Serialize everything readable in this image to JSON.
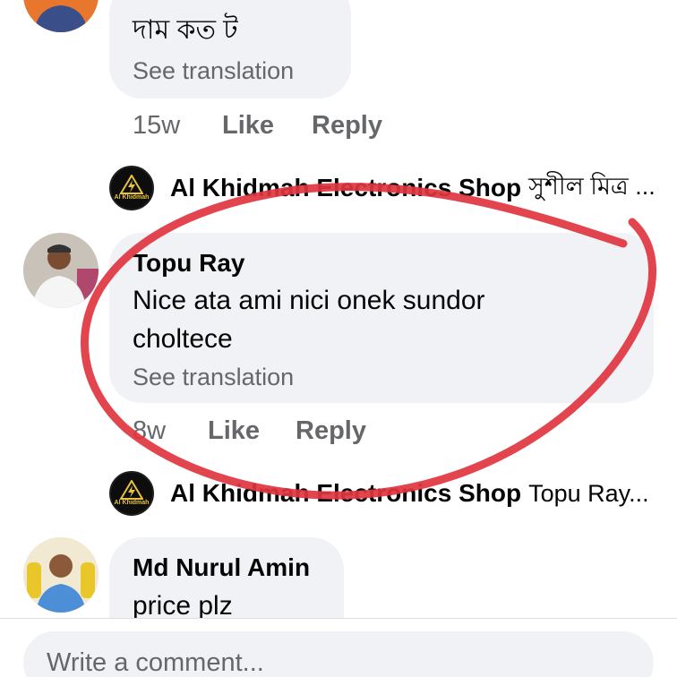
{
  "comments": [
    {
      "text": "দাম কত ট",
      "see_translation": "See translation",
      "time": "15w",
      "like": "Like",
      "reply": "Reply",
      "reply_preview": {
        "author": "Al Khidmah Electronics Shop",
        "preview": "সুশীল মিত্র ...",
        "logo_text": "Al Khidmah"
      }
    },
    {
      "author": "Topu Ray",
      "text_lines": [
        "Nice ata ami nici onek sundor",
        "choltece"
      ],
      "see_translation": "See translation",
      "time": "8w",
      "like": "Like",
      "reply": "Reply",
      "reply_preview": {
        "author": "Al Khidmah Electronics Shop",
        "preview": "Topu Ray...",
        "logo_text": "Al Khidmah"
      }
    },
    {
      "author": "Md Nurul Amin",
      "text": "price plz"
    }
  ],
  "composer": {
    "placeholder": "Write a comment..."
  },
  "colors": {
    "bubble": "#f0f2f5",
    "secondary_text": "#65676b",
    "annotation": "#e0353f"
  }
}
